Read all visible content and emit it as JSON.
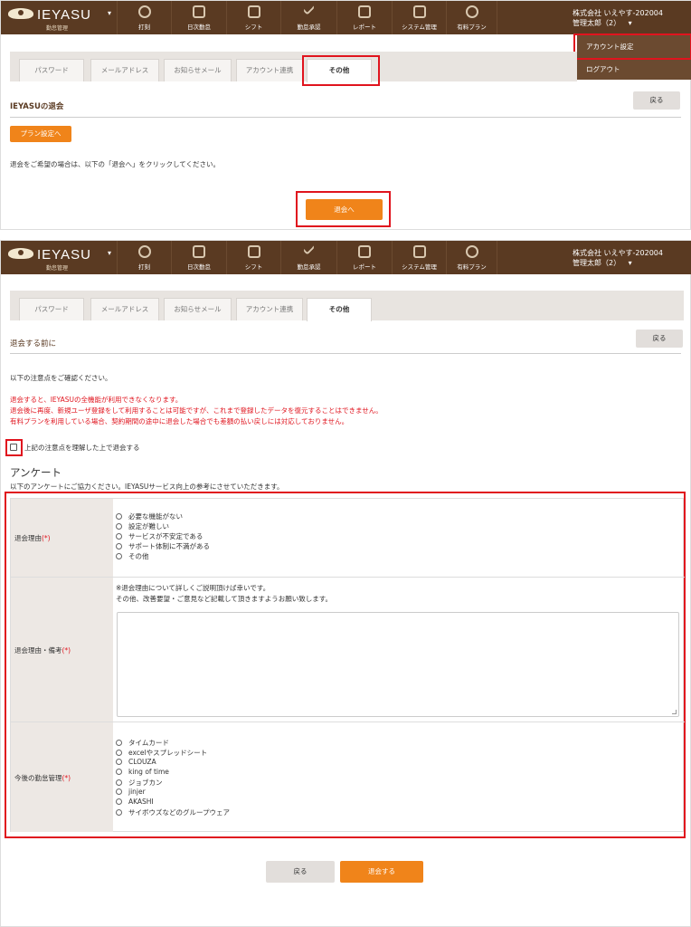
{
  "nav": {
    "logo_text": "IEYASU",
    "logo_caret": "▾",
    "logo_sub": "勤怠管理",
    "items": [
      {
        "label": "打刻",
        "icon": "clock-icon"
      },
      {
        "label": "日次勤怠",
        "icon": "calendar-icon"
      },
      {
        "label": "シフト",
        "icon": "shift-icon"
      },
      {
        "label": "勤怠承認",
        "icon": "check-icon"
      },
      {
        "label": "レポート",
        "icon": "document-icon"
      },
      {
        "label": "システム管理",
        "icon": "monitor-icon"
      },
      {
        "label": "有料プラン",
        "icon": "user-icon"
      }
    ],
    "company": "株式会社 いえやす-202004",
    "user": "管理太郎（2）",
    "user_caret": "▾"
  },
  "dropdown": {
    "account_settings": "アカウント設定",
    "logout": "ログアウト"
  },
  "tabs": [
    "パスワード",
    "メールアドレス",
    "お知らせメール",
    "アカウント連携",
    "その他"
  ],
  "panel1": {
    "title": "IEYASUの退会",
    "back_button": "戻る",
    "plan_button": "プラン設定へ",
    "instruction": "退会をご希望の場合は、以下の「退会へ」をクリックしてください。",
    "withdraw_button": "退会へ"
  },
  "panel2": {
    "title": "退会する前に",
    "back_button": "戻る",
    "confirm_text": "以下の注意点をご確認ください。",
    "warnings": [
      "退会すると、IEYASUの全機能が利用できなくなります。",
      "退会後に再度、新規ユーザ登録をして利用することは可能ですが、これまで登録したデータを復元することはできません。",
      "有料プランを利用している場合、契約期間の途中に退会した場合でも差額の払い戻しには対応しておりません。"
    ],
    "checkbox_label": "上記の注意点を理解した上で退会する",
    "survey_heading": "アンケート",
    "survey_intro": "以下のアンケートにご協力ください。IEYASUサービス向上の参考にさせていただきます。",
    "required_mark": "(*)",
    "reason_label": "退会理由",
    "reason_options": [
      "必要な機能がない",
      "設定が難しい",
      "サービスが不安定である",
      "サポート体制に不満がある",
      "その他"
    ],
    "remarks_label": "退会理由・備考",
    "remarks_hint_1": "※退会理由について詳しくご説明頂けば幸いです。",
    "remarks_hint_2": "その他、改善要望・ご意見など記載して頂きますようお願い致します。",
    "future_label": "今後の勤怠管理",
    "future_options": [
      "タイムカード",
      "excelやスプレッドシート",
      "CLOUZA",
      "king of time",
      "ジョブカン",
      "jinjer",
      "AKASHI",
      "サイボウズなどのグループウェア"
    ],
    "footer_back": "戻る",
    "footer_submit": "退会する"
  },
  "colors": {
    "nav_bg": "#5a3a22",
    "accent": "#f0841a",
    "highlight": "#e0141e"
  }
}
